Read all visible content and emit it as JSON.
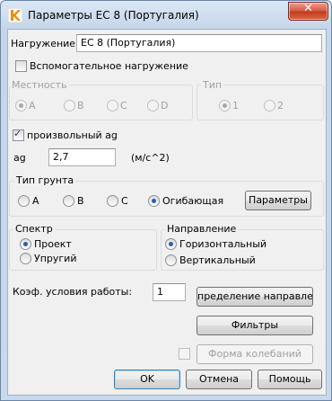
{
  "window": {
    "title": "Параметры EC 8 (Португалия)",
    "close_glyph": "✕",
    "icon": "app-k-icon"
  },
  "load": {
    "label": "Нагружение:",
    "value": "EC 8 (Португалия)",
    "aux_label": "Вспомогательное нагружение",
    "aux_checked": false
  },
  "terrain": {
    "title": "Местность",
    "options": [
      "A",
      "B",
      "C",
      "D"
    ],
    "selected": "A",
    "enabled": false
  },
  "type": {
    "title": "Тип",
    "options": [
      "1",
      "2"
    ],
    "selected": "1",
    "enabled": false
  },
  "custom_ag": {
    "label": "произвольный ag",
    "checked": true,
    "ag_label": "ag",
    "ag_value": "2,7",
    "unit": "(м/с^2)"
  },
  "soil": {
    "title": "Тип грунта",
    "options": [
      "A",
      "B",
      "C",
      "Огибающая"
    ],
    "selected": "Огибающая",
    "params_button": "Параметры"
  },
  "spectrum": {
    "title": "Спектр",
    "options": [
      "Проект",
      "Упругий"
    ],
    "selected": "Проект"
  },
  "direction": {
    "title": "Направление",
    "options": [
      "Горизонтальный",
      "Вертикальный"
    ],
    "selected": "Горизонтальный"
  },
  "work_coef": {
    "label": "Коэф. условия работы:",
    "value": "1"
  },
  "buttons": {
    "direction_def": "пределение направлени",
    "filters": "Фильтры",
    "mode_shapes": "Форма колебаний",
    "ok": "OK",
    "cancel": "Отмена",
    "help": "Помощь"
  },
  "colors": {
    "accent": "#2a5fb0",
    "close": "#c13a22"
  }
}
